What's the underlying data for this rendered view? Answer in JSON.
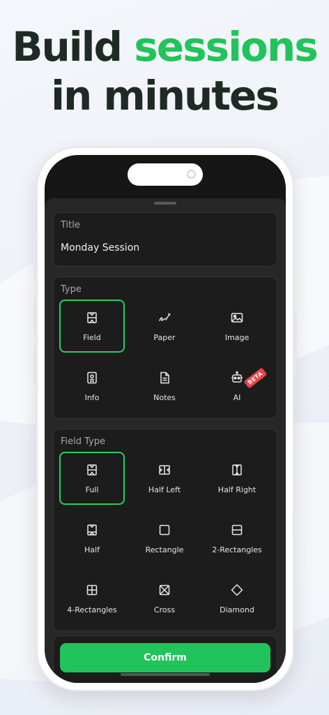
{
  "headline": {
    "line1_plain": "Build",
    "line1_accent": "sessions",
    "line2": "in minutes"
  },
  "colors": {
    "accent": "#21c45a",
    "selected_border": "#2fca64",
    "beta_badge": "#e8434a",
    "sheet_bg": "#272727"
  },
  "title_section": {
    "label": "Title",
    "value": "Monday Session"
  },
  "type_section": {
    "label": "Type",
    "items": [
      {
        "label": "Field",
        "icon": "field-icon",
        "selected": true
      },
      {
        "label": "Paper",
        "icon": "pen-icon",
        "selected": false
      },
      {
        "label": "Image",
        "icon": "image-icon",
        "selected": false
      },
      {
        "label": "Info",
        "icon": "info-card-icon",
        "selected": false
      },
      {
        "label": "Notes",
        "icon": "document-icon",
        "selected": false
      },
      {
        "label": "AI",
        "icon": "robot-icon",
        "selected": false,
        "badge": "BETA"
      }
    ]
  },
  "field_type_section": {
    "label": "Field Type",
    "items": [
      {
        "label": "Full",
        "icon": "full-field-icon",
        "selected": true
      },
      {
        "label": "Half Left",
        "icon": "half-left-icon",
        "selected": false
      },
      {
        "label": "Half Right",
        "icon": "half-right-icon",
        "selected": false
      },
      {
        "label": "Half",
        "icon": "half-field-icon",
        "selected": false
      },
      {
        "label": "Rectangle",
        "icon": "rectangle-icon",
        "selected": false
      },
      {
        "label": "2-Rectangles",
        "icon": "two-rectangles-icon",
        "selected": false
      },
      {
        "label": "4-Rectangles",
        "icon": "four-rectangles-icon",
        "selected": false
      },
      {
        "label": "Cross",
        "icon": "cross-icon",
        "selected": false
      },
      {
        "label": "Diamond",
        "icon": "diamond-icon",
        "selected": false
      }
    ]
  },
  "confirm_label": "Confirm"
}
